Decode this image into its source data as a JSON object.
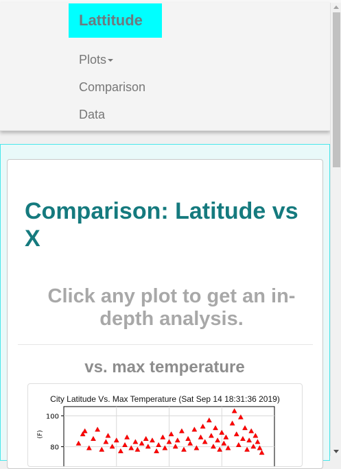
{
  "navbar": {
    "brand": "Lattitude",
    "items": [
      {
        "label": "Plots",
        "has_dropdown": true
      },
      {
        "label": "Comparison",
        "has_dropdown": false
      },
      {
        "label": "Data",
        "has_dropdown": false
      }
    ]
  },
  "main": {
    "title": "Comparison: Latitude vs X",
    "subtitle": "Click any plot to get an in-depth analysis.",
    "sections": [
      {
        "heading": "vs. max temperature"
      }
    ]
  },
  "chart_data": {
    "type": "scatter",
    "title": "City Latitude Vs. Max Temperature (Sat Sep 14 18:31:36 2019)",
    "ylabel": "(F)",
    "y_ticks": [
      80,
      100
    ],
    "marker": "triangle",
    "series_color": "#ff0000",
    "points": [
      {
        "x": -38,
        "y": 82
      },
      {
        "x": -36,
        "y": 88
      },
      {
        "x": -35,
        "y": 90
      },
      {
        "x": -33,
        "y": 79
      },
      {
        "x": -31,
        "y": 85
      },
      {
        "x": -29,
        "y": 91
      },
      {
        "x": -27,
        "y": 78
      },
      {
        "x": -25,
        "y": 83
      },
      {
        "x": -24,
        "y": 87
      },
      {
        "x": -22,
        "y": 80
      },
      {
        "x": -20,
        "y": 84
      },
      {
        "x": -18,
        "y": 77
      },
      {
        "x": -16,
        "y": 81
      },
      {
        "x": -15,
        "y": 86
      },
      {
        "x": -13,
        "y": 79
      },
      {
        "x": -11,
        "y": 83
      },
      {
        "x": -10,
        "y": 78
      },
      {
        "x": -8,
        "y": 82
      },
      {
        "x": -6,
        "y": 85
      },
      {
        "x": -5,
        "y": 80
      },
      {
        "x": -3,
        "y": 84
      },
      {
        "x": -1,
        "y": 77
      },
      {
        "x": 0,
        "y": 81
      },
      {
        "x": 2,
        "y": 86
      },
      {
        "x": 3,
        "y": 79
      },
      {
        "x": 5,
        "y": 83
      },
      {
        "x": 6,
        "y": 88
      },
      {
        "x": 8,
        "y": 80
      },
      {
        "x": 9,
        "y": 84
      },
      {
        "x": 11,
        "y": 90
      },
      {
        "x": 12,
        "y": 78
      },
      {
        "x": 14,
        "y": 85
      },
      {
        "x": 15,
        "y": 82
      },
      {
        "x": 17,
        "y": 91
      },
      {
        "x": 18,
        "y": 79
      },
      {
        "x": 20,
        "y": 86
      },
      {
        "x": 21,
        "y": 93
      },
      {
        "x": 22,
        "y": 83
      },
      {
        "x": 24,
        "y": 97
      },
      {
        "x": 25,
        "y": 87
      },
      {
        "x": 26,
        "y": 80
      },
      {
        "x": 27,
        "y": 92
      },
      {
        "x": 28,
        "y": 84
      },
      {
        "x": 29,
        "y": 78
      },
      {
        "x": 30,
        "y": 89
      },
      {
        "x": 31,
        "y": 82
      },
      {
        "x": 32,
        "y": 86
      },
      {
        "x": 33,
        "y": 79
      },
      {
        "x": 35,
        "y": 95
      },
      {
        "x": 36,
        "y": 103
      },
      {
        "x": 37,
        "y": 88
      },
      {
        "x": 38,
        "y": 81
      },
      {
        "x": 39,
        "y": 99
      },
      {
        "x": 40,
        "y": 85
      },
      {
        "x": 41,
        "y": 92
      },
      {
        "x": 42,
        "y": 78
      },
      {
        "x": 43,
        "y": 84
      },
      {
        "x": 44,
        "y": 90
      },
      {
        "x": 45,
        "y": 80
      },
      {
        "x": 46,
        "y": 87
      },
      {
        "x": 47,
        "y": 83
      },
      {
        "x": 48,
        "y": 79
      },
      {
        "x": 49,
        "y": 76
      }
    ]
  }
}
